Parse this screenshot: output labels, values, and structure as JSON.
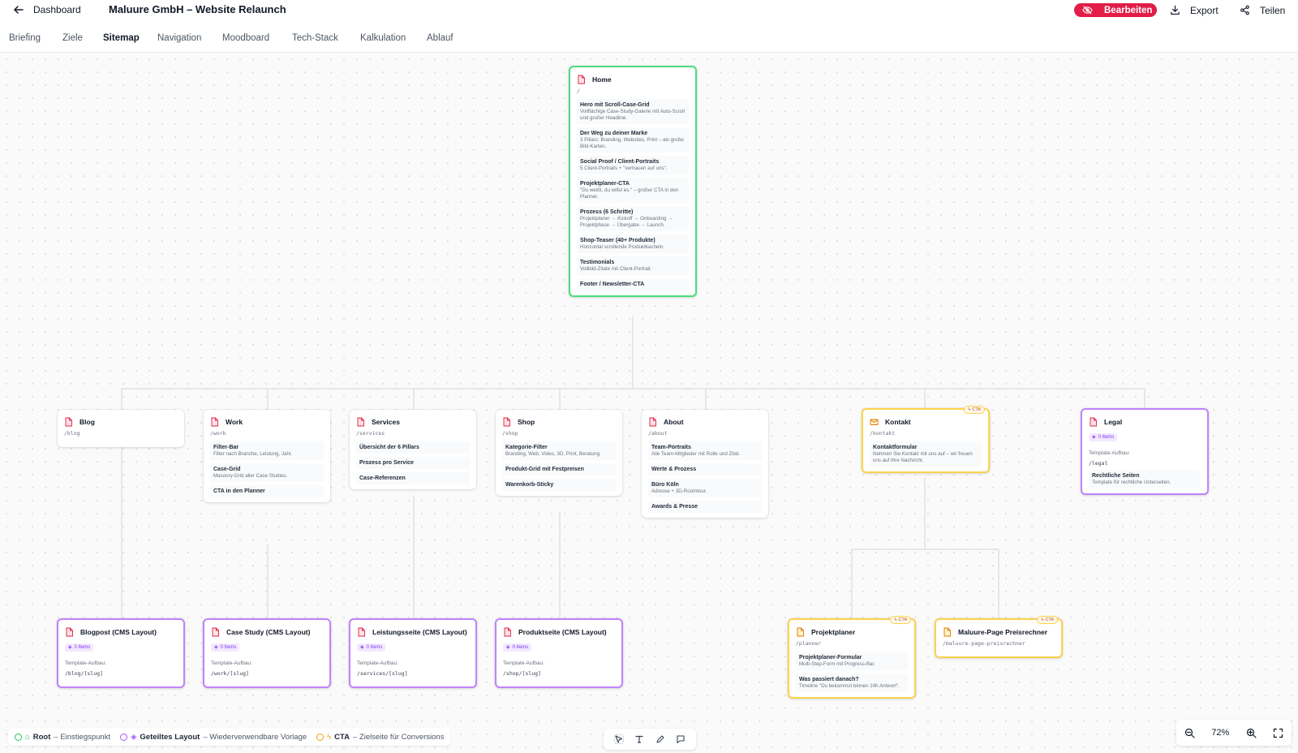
{
  "header": {
    "back_label": "Dashboard",
    "title": "Maluure GmbH – Website Relaunch",
    "edit_label": "Bearbeiten",
    "export_label": "Export",
    "share_label": "Teilen"
  },
  "tabs": [
    {
      "label": "Briefing"
    },
    {
      "label": "Ziele"
    },
    {
      "label": "Sitemap",
      "active": true
    },
    {
      "label": "Navigation"
    },
    {
      "label": "Moodboard"
    },
    {
      "label": "Tech-Stack"
    },
    {
      "label": "Kalkulation"
    },
    {
      "label": "Ablauf"
    }
  ],
  "nodes": {
    "home": {
      "title": "Home",
      "path": "/",
      "sections": [
        {
          "title": "Hero mit Scroll-Case-Grid",
          "desc": "Vollflächige Case-Study-Galerie mit Auto-Scroll und großer Headline."
        },
        {
          "title": "Der Weg zu deiner Marke",
          "desc": "3 Pillars: Branding, Websites, Print – als große Bild-Karten."
        },
        {
          "title": "Social Proof / Client-Portraits",
          "desc": "5 Client-Portraits + \"vertrauen auf uns\"."
        },
        {
          "title": "Projektplaner-CTA",
          "desc": "\"Du weißt, du willst es.\" – großer CTA in den Planner."
        },
        {
          "title": "Prozess (6 Schritte)",
          "desc": "Projektplaner → Kickoff → Onboarding → Projektphase → Übergabe → Launch."
        },
        {
          "title": "Shop-Teaser (40+ Produkte)",
          "desc": "Horizontal scrollende Produktkacheln."
        },
        {
          "title": "Testimonials",
          "desc": "Vollbild-Zitate mit Client-Portrait."
        },
        {
          "title": "Footer / Newsletter-CTA",
          "desc": ""
        }
      ]
    },
    "blog": {
      "title": "Blog",
      "path": "/blog",
      "sections": []
    },
    "work": {
      "title": "Work",
      "path": "/work",
      "sections": [
        {
          "title": "Filter-Bar",
          "desc": "Filter nach Branche, Leistung, Jahr."
        },
        {
          "title": "Case-Grid",
          "desc": "Masonry-Grid aller Case Studies."
        },
        {
          "title": "CTA in den Planner",
          "desc": ""
        }
      ]
    },
    "services": {
      "title": "Services",
      "path": "/services",
      "sections": [
        {
          "title": "Übersicht der 6 Pillars",
          "desc": ""
        },
        {
          "title": "Prozess pro Service",
          "desc": ""
        },
        {
          "title": "Case-Referenzen",
          "desc": ""
        }
      ]
    },
    "shop": {
      "title": "Shop",
      "path": "/shop",
      "sections": [
        {
          "title": "Kategorie-Filter",
          "desc": "Branding, Web, Video, 3D, Print, Beratung."
        },
        {
          "title": "Produkt-Grid mit Festpreisen",
          "desc": ""
        },
        {
          "title": "Warenkorb-Sticky",
          "desc": ""
        }
      ]
    },
    "about": {
      "title": "About",
      "path": "/about",
      "sections": [
        {
          "title": "Team-Portraits",
          "desc": "Alle Team-Mitglieder mit Rolle und Zitat."
        },
        {
          "title": "Werte & Prozess",
          "desc": ""
        },
        {
          "title": "Büro Köln",
          "desc": "Adresse + 3D-Roomtour."
        },
        {
          "title": "Awards & Presse",
          "desc": ""
        }
      ]
    },
    "kontakt": {
      "title": "Kontakt",
      "path": "/kontakt",
      "chip": "CTA",
      "sections": [
        {
          "title": "Kontaktformular",
          "desc": "Nehmen Sie Kontakt mit uns auf – wir freuen uns auf Ihre Nachricht."
        }
      ]
    },
    "legal": {
      "title": "Legal",
      "badge": "0 Items",
      "template_label": "Template-Aufbau:",
      "template_path": "/legal",
      "sections": [
        {
          "title": "Rechtliche Seiten",
          "desc": "Template für rechtliche Unterseiten."
        }
      ]
    },
    "blogpost": {
      "title": "Blogpost (CMS Layout)",
      "badge": "0 Items",
      "template_label": "Template-Aufbau:",
      "template_path": "/blog/[slug]"
    },
    "casestudy": {
      "title": "Case Study (CMS Layout)",
      "badge": "0 Items",
      "template_label": "Template-Aufbau:",
      "template_path": "/work/[slug]"
    },
    "leistung": {
      "title": "Leistungsseite (CMS Layout)",
      "badge": "0 Items",
      "template_label": "Template-Aufbau:",
      "template_path": "/services/[slug]"
    },
    "produkt": {
      "title": "Produktseite (CMS Layout)",
      "badge": "0 Items",
      "template_label": "Template-Aufbau:",
      "template_path": "/shop/[slug]"
    },
    "planer": {
      "title": "Projektplaner",
      "path": "/planner",
      "chip": "CTA",
      "sections": [
        {
          "title": "Projektplaner-Formular",
          "desc": "Multi-Step-Form mit Progress-Bar."
        },
        {
          "title": "Was passiert danach?",
          "desc": "Timeline \"Du bekommst binnen 24h Antwort\"."
        }
      ]
    },
    "preisrechner": {
      "title": "Maluure-Page Preisrechner",
      "path": "/maluure-page-preisrechner",
      "chip": "CTA",
      "sections": []
    }
  },
  "legend": [
    {
      "label": "Root",
      "desc": "– Einstiegspunkt",
      "color": "#22c55e",
      "icon": "home-icon"
    },
    {
      "label": "Geteiltes Layout",
      "desc": "– Wiederverwendbare Vorlage",
      "color": "#a855f7",
      "icon": "layers-icon"
    },
    {
      "label": "CTA",
      "desc": "– Zielseite für Conversions",
      "color": "#f59e0b",
      "icon": "bolt-icon"
    }
  ],
  "zoom": {
    "level": "72%"
  },
  "colors": {
    "accent": "#e11d48",
    "root": "#4ade80",
    "cta": "#fcd34d",
    "layout": "#c084fc"
  }
}
